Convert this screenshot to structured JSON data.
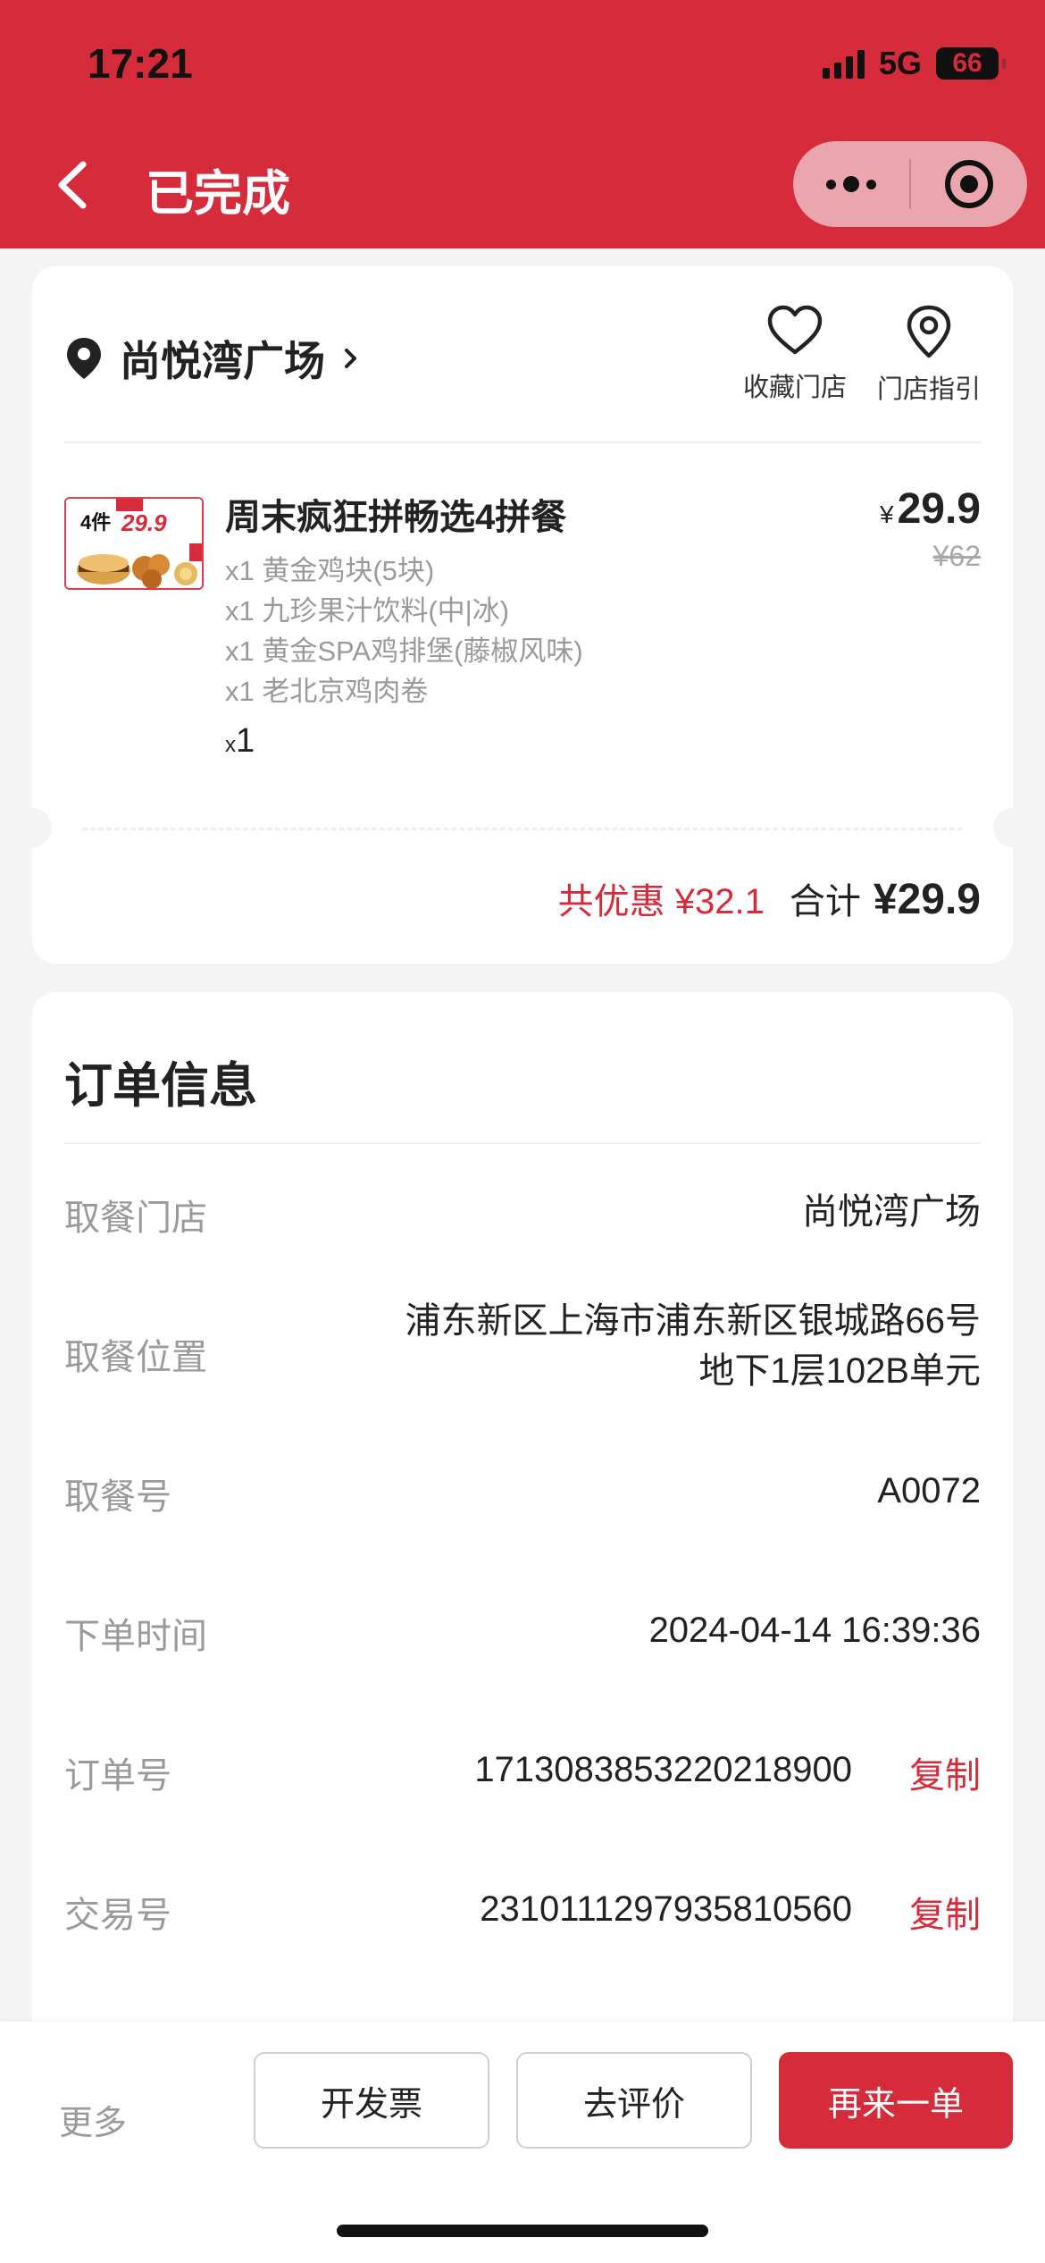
{
  "status_bar": {
    "time": "17:21",
    "network": "5G",
    "battery": "66"
  },
  "nav": {
    "title": "已完成"
  },
  "store": {
    "name": "尚悦湾广场",
    "favorite_label": "收藏门店",
    "guide_label": "门店指引"
  },
  "product": {
    "image_badge_text": "4件29.9",
    "title": "周末疯狂拼畅选4拼餐",
    "items": [
      "x1 黄金鸡块(5块)",
      "x1 九珍果汁饮料(中|冰)",
      "x1 黄金SPA鸡排堡(藤椒风味)",
      "x1 老北京鸡肉卷"
    ],
    "qty_prefix": "x",
    "qty": "1",
    "currency": "¥",
    "price": "29.9",
    "original_price": "¥62"
  },
  "totals": {
    "discount_label": "共优惠 ¥32.1",
    "sum_label": "合计",
    "sum_value": "¥29.9"
  },
  "order_info": {
    "title": "订单信息",
    "rows": [
      {
        "label": "取餐门店",
        "value": "尚悦湾广场"
      },
      {
        "label": "取餐位置",
        "value_line1": "浦东新区上海市浦东新区银城路66号",
        "value_line2": "地下1层102B单元"
      },
      {
        "label": "取餐号",
        "value": "A0072"
      },
      {
        "label": "下单时间",
        "value": "2024-04-14 16:39:36"
      },
      {
        "label": "订单号",
        "value": "1713083853220218900",
        "action": "复制"
      },
      {
        "label": "交易号",
        "value": "2310111297935810560",
        "action": "复制"
      }
    ]
  },
  "bottom_bar": {
    "more": "更多",
    "invoice": "开发票",
    "review": "去评价",
    "reorder": "再来一单"
  },
  "colors": {
    "brand_red": "#d62b3a"
  }
}
